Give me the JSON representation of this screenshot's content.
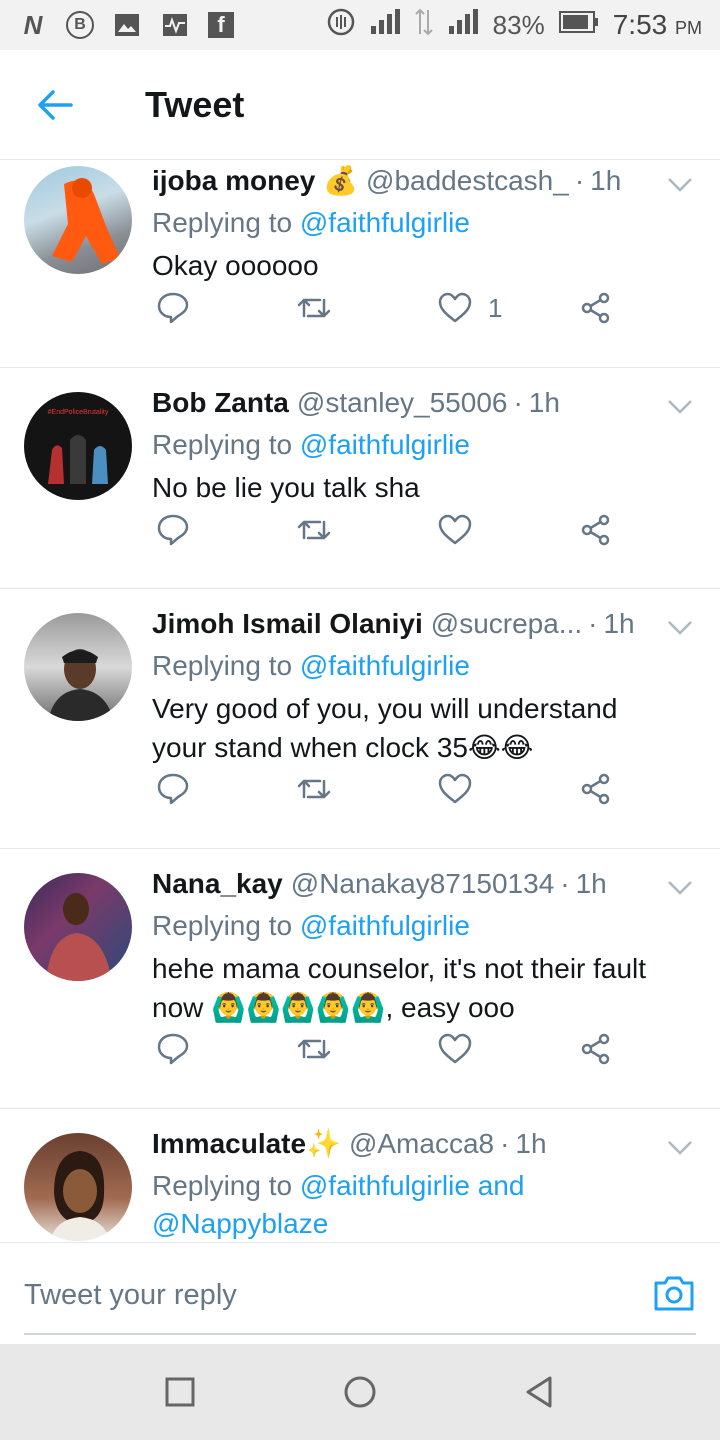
{
  "status_bar": {
    "icons_left": [
      "N",
      "B",
      "image-icon",
      "activity-icon",
      "f"
    ],
    "battery": "83%",
    "time": "7:53",
    "ampm": "PM"
  },
  "header": {
    "title": "Tweet"
  },
  "tweets": [
    {
      "name": "ijoba money",
      "name_emoji": "💰",
      "handle": "@baddestcash_",
      "time": "1h",
      "replying_prefix": "Replying to",
      "replying_to": "@faithfulgirlie",
      "text_lines": [
        "Okay oooooo"
      ],
      "like_count": "1"
    },
    {
      "name": "Bob Zanta",
      "name_emoji": "",
      "handle": "@stanley_55006",
      "time": "1h",
      "replying_prefix": "Replying to",
      "replying_to": "@faithfulgirlie",
      "text_lines": [
        "No be lie you talk sha"
      ],
      "like_count": "",
      "avatar_text": "#EndPoliceBrutality"
    },
    {
      "name": "Jimoh Ismail Olaniyi",
      "name_emoji": "",
      "handle": "@sucrepa...",
      "time": "1h",
      "replying_prefix": "Replying to",
      "replying_to": "@faithfulgirlie",
      "text_lines": [
        "Very good of you, you will understand",
        "your stand when clock 35😂😂"
      ],
      "like_count": ""
    },
    {
      "name": "Nana_kay",
      "name_emoji": "",
      "handle": "@Nanakay87150134",
      "time": "1h",
      "replying_prefix": "Replying to",
      "replying_to": "@faithfulgirlie",
      "text_lines": [
        "hehe mama counselor, it's not their fault",
        "now 🙆‍♂️🙆‍♂️🙆‍♂️🙆‍♂️🙆‍♂️, easy ooo"
      ],
      "like_count": ""
    },
    {
      "name": "Immaculate",
      "name_emoji": "✨",
      "handle": "@Amacca8",
      "time": "1h",
      "replying_prefix": "Replying to",
      "replying_to": "@faithfulgirlie and",
      "replying_to_2": "@Nappyblaze",
      "text_lines": [],
      "like_count": ""
    }
  ],
  "reply_bar": {
    "placeholder": "Tweet your reply"
  },
  "colors": {
    "accent": "#1da1f2",
    "muted": "#657786",
    "text": "#14171a",
    "divider": "#e1e8ed"
  }
}
